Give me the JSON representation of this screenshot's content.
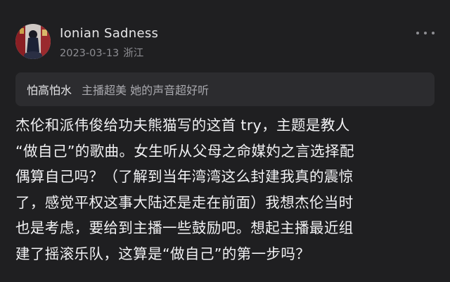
{
  "post": {
    "author": "Ionian Sadness",
    "date": "2023-03-13",
    "location": "浙江",
    "more_icon": "more-dots-icon",
    "avatar_icon": "avatar-figure-icon"
  },
  "quote": {
    "user": "怕高怕水",
    "text": "主播超美 她的声音超好听"
  },
  "content": {
    "lines": [
      "杰伦和派伟俊给功夫熊猫写的这首 try，主题是教人",
      "“做自己”的歌曲。女生听从父母之命媒妁之言选择配",
      "偶算自己吗？（了解到当年湾湾这么封建我真的震惊",
      "了，感觉平权这事大陆还是走在前面）我想杰伦当时",
      "也是考虑，要给到主播一些鼓励吧。想起主播最近组",
      "建了摇滚乐队，这算是“做自己”的第一步吗？"
    ]
  },
  "colors": {
    "background": "#1f1f21",
    "quote_background": "#2c2c2f",
    "text_primary": "#f2f2f4",
    "text_secondary": "#8e8e93"
  }
}
